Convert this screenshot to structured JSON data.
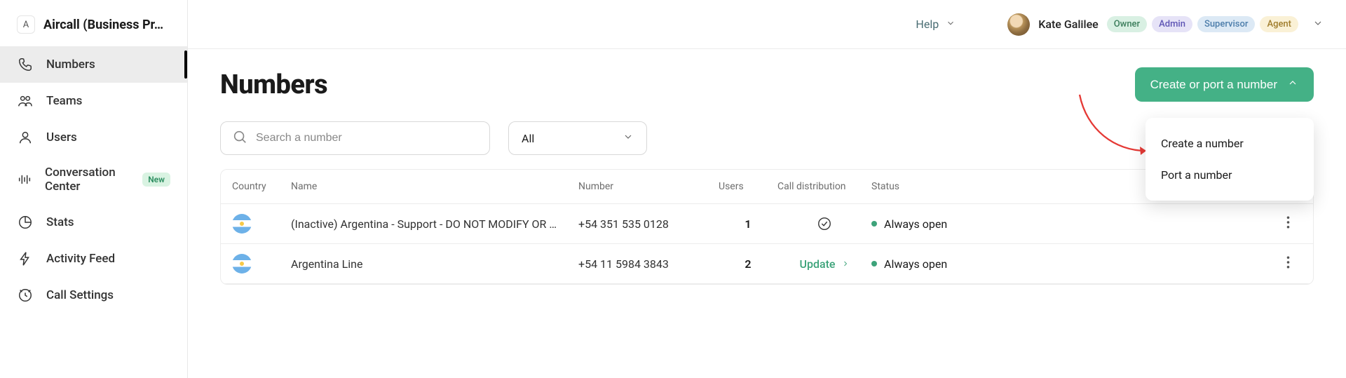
{
  "brand": {
    "initial": "A",
    "name": "Aircall (Business Pr…"
  },
  "sidebar": {
    "items": [
      {
        "label": "Numbers",
        "icon": "phone-icon",
        "active": true
      },
      {
        "label": "Teams",
        "icon": "teams-icon"
      },
      {
        "label": "Users",
        "icon": "user-icon"
      },
      {
        "label": "Conversation Center",
        "icon": "waveform-icon",
        "badge": "New"
      },
      {
        "label": "Stats",
        "icon": "stats-icon"
      },
      {
        "label": "Activity Feed",
        "icon": "bolt-icon"
      },
      {
        "label": "Call Settings",
        "icon": "clock-icon"
      }
    ]
  },
  "topbar": {
    "help": "Help",
    "user": "Kate Galilee",
    "badges": [
      {
        "label": "Owner",
        "cls": "badge-owner"
      },
      {
        "label": "Admin",
        "cls": "badge-admin"
      },
      {
        "label": "Supervisor",
        "cls": "badge-supervisor"
      },
      {
        "label": "Agent",
        "cls": "badge-agent"
      }
    ]
  },
  "page": {
    "title": "Numbers",
    "cta": "Create or port a number",
    "dropdown": [
      "Create a number",
      "Port a number"
    ],
    "search_placeholder": "Search a number",
    "filter_value": "All"
  },
  "table": {
    "headers": {
      "country": "Country",
      "name": "Name",
      "number": "Number",
      "users": "Users",
      "dist": "Call distribution",
      "status": "Status"
    },
    "rows": [
      {
        "country": "argentina",
        "name": "(Inactive) Argentina - Support - DO NOT MODIFY OR …",
        "number": "+54 351 535 0128",
        "users": "1",
        "dist_type": "ok",
        "status": "Always open"
      },
      {
        "country": "argentina",
        "name": "Argentina Line",
        "number": "+54 11 5984 3843",
        "users": "2",
        "dist_type": "update",
        "dist_label": "Update",
        "status": "Always open"
      }
    ]
  }
}
